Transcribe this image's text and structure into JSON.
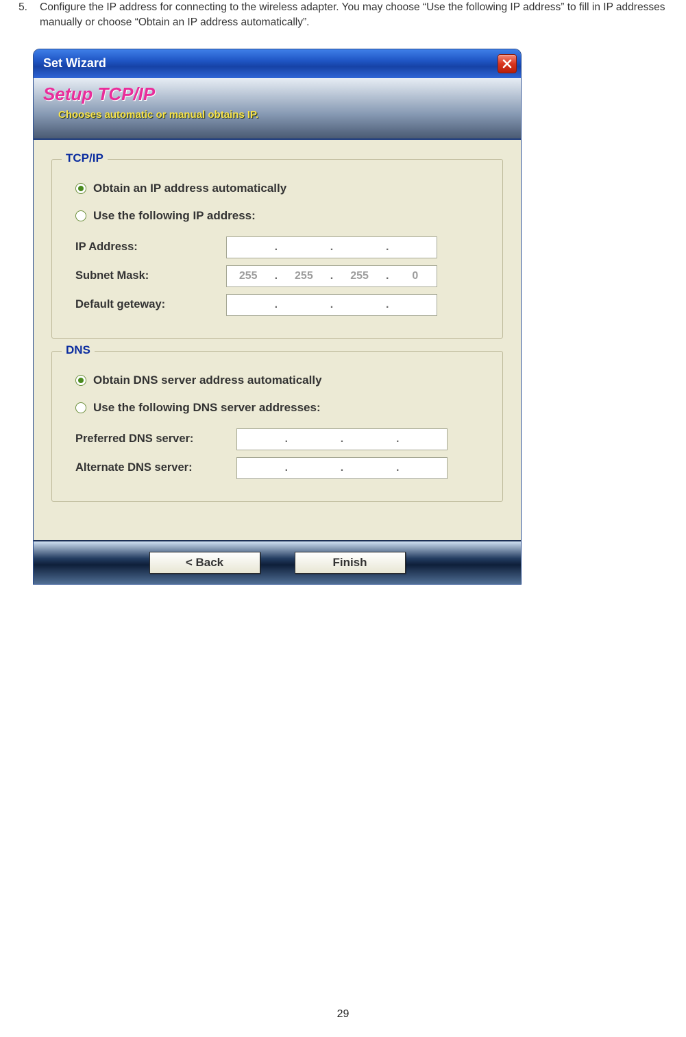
{
  "instruction": {
    "number": "5.",
    "text": "Configure the IP address for connecting to the wireless adapter. You may choose “Use the following IP address” to fill in IP addresses manually or choose “Obtain an IP address automatically”."
  },
  "titlebar": {
    "title": "Set Wizard",
    "close_icon": "close"
  },
  "wizard_header": {
    "title": "Setup TCP/IP",
    "subtitle": "Chooses automatic or manual obtains IP."
  },
  "tcpip": {
    "legend": "TCP/IP",
    "option_auto": "Obtain an IP address automatically",
    "option_manual": "Use the following IP address:",
    "selected": "auto",
    "fields": {
      "ip_label": "IP Address:",
      "ip_value": [
        "",
        "",
        "",
        ""
      ],
      "subnet_label": "Subnet Mask:",
      "subnet_value": [
        "255",
        "255",
        "255",
        "0"
      ],
      "gateway_label": "Default geteway:",
      "gateway_value": [
        "",
        "",
        "",
        ""
      ]
    }
  },
  "dns": {
    "legend": "DNS",
    "option_auto": "Obtain DNS server address automatically",
    "option_manual": "Use the following DNS server addresses:",
    "selected": "auto",
    "fields": {
      "preferred_label": "Preferred DNS server:",
      "preferred_value": [
        "",
        "",
        "",
        ""
      ],
      "alternate_label": "Alternate DNS server:",
      "alternate_value": [
        "",
        "",
        "",
        ""
      ]
    }
  },
  "footer": {
    "back_label": "< Back",
    "finish_label": "Finish"
  },
  "page_number": "29"
}
